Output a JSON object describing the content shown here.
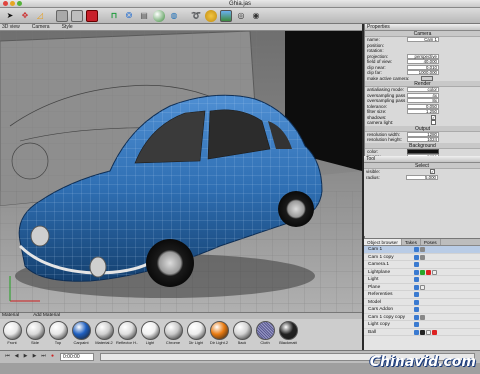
{
  "window": {
    "title": "Ghia.jas"
  },
  "toolbar": {
    "icons": [
      "arrow-icon",
      "move-icon",
      "measure-icon",
      "cube-grey-icon",
      "cube-grey2-icon",
      "cube-red-icon",
      "magnet-icon",
      "sculpt-icon",
      "render-icon",
      "sphere-icon",
      "material-icon",
      "anim-icon",
      "coin-icon",
      "landscape-icon",
      "light-icon",
      "camera-icon"
    ]
  },
  "viewport": {
    "view_menu": "3D view",
    "camera_menu": "Camera",
    "style_menu": "Style",
    "colors": {
      "car": "#2f6fb3",
      "floor": "#9a9a9a",
      "backdrop": "#0d0d0d"
    }
  },
  "properties": {
    "title": "Properties",
    "camera_section": "Camera",
    "rows": [
      {
        "label": "name:",
        "value": "Cam 1"
      },
      {
        "label": "position:",
        "value": ""
      },
      {
        "label": "rotation:",
        "value": ""
      },
      {
        "label": "projection:",
        "value": "perspective"
      },
      {
        "label": "field of view:",
        "value": "40.000"
      },
      {
        "label": "clip near:",
        "value": "0.010"
      },
      {
        "label": "clip far:",
        "value": "1000.000"
      },
      {
        "label": "make active camera:",
        "value": ""
      }
    ],
    "render_section": "Render",
    "render_rows": [
      {
        "label": "antialiasing mode:",
        "value": "color"
      },
      {
        "label": "oversampling pass 1:",
        "value": "4x"
      },
      {
        "label": "oversampling pass 2:",
        "value": "8x"
      },
      {
        "label": "tolerance:",
        "value": "0.050"
      },
      {
        "label": "filter size:",
        "value": "1.250"
      },
      {
        "label": "shadows:",
        "value": ""
      },
      {
        "label": "camera light:",
        "value": ""
      }
    ],
    "output_section": "Output",
    "output_rows": [
      {
        "label": "resolution width:",
        "value": "1280"
      },
      {
        "label": "resolution height:",
        "value": "1024"
      }
    ],
    "background_section": "Background",
    "background_rows": [
      {
        "label": "color:",
        "value": ""
      },
      {
        "label": "image:",
        "value": "none"
      }
    ]
  },
  "tool": {
    "title": "Tool",
    "section": "Select",
    "rows": [
      {
        "label": "visible:",
        "value": ""
      },
      {
        "label": "radius:",
        "value": "5.000"
      }
    ]
  },
  "object_browser": {
    "tabs": [
      "Object browser",
      "Takes",
      "Poses"
    ],
    "items": [
      {
        "name": "Cam 1"
      },
      {
        "name": "Cam 1 copy"
      },
      {
        "name": "Camera.1"
      },
      {
        "name": "Lightplane"
      },
      {
        "name": "Light"
      },
      {
        "name": "Plane"
      },
      {
        "name": "Referenties"
      },
      {
        "name": "Model"
      },
      {
        "name": "Cars Addon"
      },
      {
        "name": "Cam 1 copy copy"
      },
      {
        "name": "Light copy"
      },
      {
        "name": "Ball"
      }
    ]
  },
  "materials": {
    "header": "Material",
    "add_label": "Add Material",
    "items": [
      {
        "label": "Front",
        "color": "#e8e8e8"
      },
      {
        "label": "Side",
        "color": "#d9d9d9"
      },
      {
        "label": "Top",
        "color": "#e6e6e6"
      },
      {
        "label": "Carpaint",
        "color": "#1e5fc0"
      },
      {
        "label": "Material.2",
        "color": "#cfcfcf"
      },
      {
        "label": "Reflector H...",
        "color": "#dedede"
      },
      {
        "label": "Light",
        "color": "#f0f0f0"
      },
      {
        "label": "Chrome",
        "color": "#c9c9c9"
      },
      {
        "label": "Dir Light",
        "color": "#ededed"
      },
      {
        "label": "Dir Light.2",
        "color": "#e87a10"
      },
      {
        "label": "Back",
        "color": "#d4d4d4"
      },
      {
        "label": "Cloth",
        "color": "#7b7ba8"
      },
      {
        "label": "Blackmatt",
        "color": "#222222"
      }
    ]
  },
  "timeline": {
    "frame": "0:00:00"
  },
  "watermark": "Chinavid.com"
}
